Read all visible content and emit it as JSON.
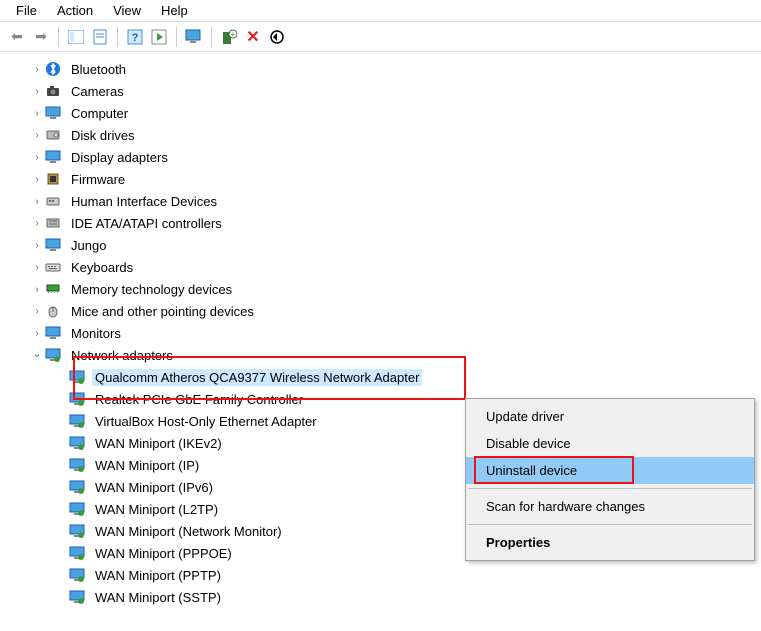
{
  "menu": {
    "file": "File",
    "action": "Action",
    "view": "View",
    "help": "Help"
  },
  "tree": {
    "bluetooth": "Bluetooth",
    "cameras": "Cameras",
    "computer": "Computer",
    "disk_drives": "Disk drives",
    "display_adapters": "Display adapters",
    "firmware": "Firmware",
    "hid": "Human Interface Devices",
    "ide": "IDE ATA/ATAPI controllers",
    "jungo": "Jungo",
    "keyboards": "Keyboards",
    "memtech": "Memory technology devices",
    "mice": "Mice and other pointing devices",
    "monitors": "Monitors",
    "network_adapters": "Network adapters",
    "na_children": {
      "qca": "Qualcomm Atheros QCA9377 Wireless Network Adapter",
      "realtek": "Realtek PCIe GbE Family Controller",
      "vbox": "VirtualBox Host-Only Ethernet Adapter",
      "ikev2": "WAN Miniport (IKEv2)",
      "ip": "WAN Miniport (IP)",
      "ipv6": "WAN Miniport (IPv6)",
      "l2tp": "WAN Miniport (L2TP)",
      "netmon": "WAN Miniport (Network Monitor)",
      "pppoe": "WAN Miniport (PPPOE)",
      "pptp": "WAN Miniport (PPTP)",
      "sstp": "WAN Miniport (SSTP)"
    }
  },
  "context_menu": {
    "update": "Update driver",
    "disable": "Disable device",
    "uninstall": "Uninstall device",
    "scan": "Scan for hardware changes",
    "properties": "Properties"
  }
}
